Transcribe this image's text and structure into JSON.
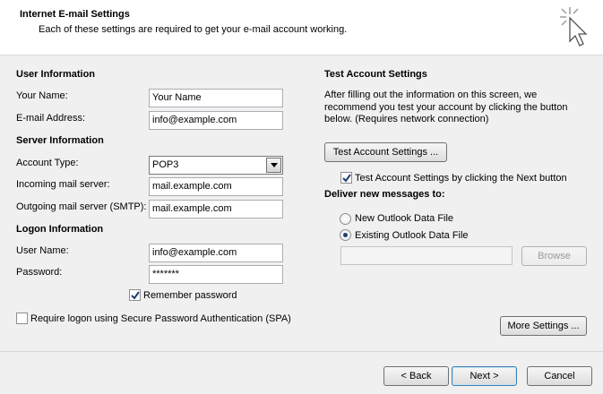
{
  "header": {
    "title": "Internet E-mail Settings",
    "subtitle": "Each of these settings are required to get your e-mail account working."
  },
  "user_info": {
    "heading": "User Information",
    "name_label": "Your Name:",
    "name_value": "Your Name",
    "email_label": "E-mail Address:",
    "email_value": "info@example.com"
  },
  "server_info": {
    "heading": "Server Information",
    "account_type_label": "Account Type:",
    "account_type_value": "POP3",
    "incoming_label": "Incoming mail server:",
    "incoming_value": "mail.example.com",
    "outgoing_label": "Outgoing mail server (SMTP):",
    "outgoing_value": "mail.example.com"
  },
  "logon_info": {
    "heading": "Logon Information",
    "username_label": "User Name:",
    "username_value": "info@example.com",
    "password_label": "Password:",
    "password_value": "*******",
    "remember_label": "Remember password",
    "remember_checked": true,
    "spa_label": "Require logon using Secure Password Authentication (SPA)",
    "spa_checked": false
  },
  "test_settings": {
    "heading": "Test Account Settings",
    "description": [
      "After filling out the information on this screen, we",
      "recommend you test your account by clicking the button",
      "below. (Requires network connection)"
    ],
    "test_button": "Test Account Settings ...",
    "auto_test_label": "Test Account Settings by clicking the Next button",
    "auto_test_checked": true
  },
  "deliver": {
    "heading": "Deliver new messages to:",
    "new_file_label": "New Outlook Data File",
    "existing_file_label": "Existing Outlook Data File",
    "selected": "existing",
    "path_value": "",
    "browse_button": "Browse"
  },
  "more_settings_button": "More Settings ...",
  "footer": {
    "back_button": "< Back",
    "next_button": "Next >",
    "cancel_button": "Cancel"
  },
  "icons": {
    "header": "cursor-click-icon",
    "dropdown": "chevron-down-icon",
    "check": "checkmark-icon"
  }
}
